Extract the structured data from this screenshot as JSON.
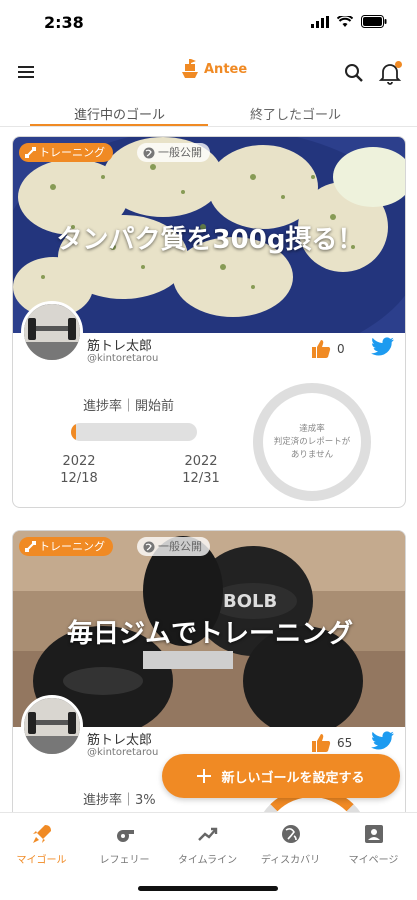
{
  "status_bar": {
    "time": "2:38"
  },
  "header": {
    "logo_text": "Antee"
  },
  "tabs": {
    "active": "進行中のゴール",
    "inactive": "終了したゴール"
  },
  "goals": [
    {
      "category": "トレーニング",
      "visibility": "一般公開",
      "title": "タンパク質を300g摂る！",
      "user_name": "筋トレ太郎",
      "user_id": "@kintoretarou",
      "likes": "0",
      "progress_label": "進捗率｜開始前",
      "progress_value": 0.04,
      "start_year": "2022",
      "start_date": "12/18",
      "end_year": "2022",
      "end_date": "12/31",
      "ring_text": "達成率\n判定済のレポートがありません"
    },
    {
      "category": "トレーニング",
      "visibility": "一般公開",
      "title": "毎日ジムでトレーニング",
      "user_name": "筋トレ太郎",
      "user_id": "@kintoretarou",
      "likes": "65",
      "progress_label": "進捗率｜3%",
      "progress_value": 0.03
    }
  ],
  "fab": {
    "label": "新しいゴールを設定する"
  },
  "bottom_nav": [
    {
      "label": "マイゴール",
      "icon": "rocket-icon",
      "active": true
    },
    {
      "label": "レフェリー",
      "icon": "whistle-icon",
      "active": false
    },
    {
      "label": "タイムライン",
      "icon": "trend-icon",
      "active": false
    },
    {
      "label": "ディスカバリ",
      "icon": "globe-icon",
      "active": false
    },
    {
      "label": "マイページ",
      "icon": "profile-icon",
      "active": false
    }
  ],
  "colors": {
    "accent": "#f08a24",
    "twitter": "#1d9bf0"
  }
}
